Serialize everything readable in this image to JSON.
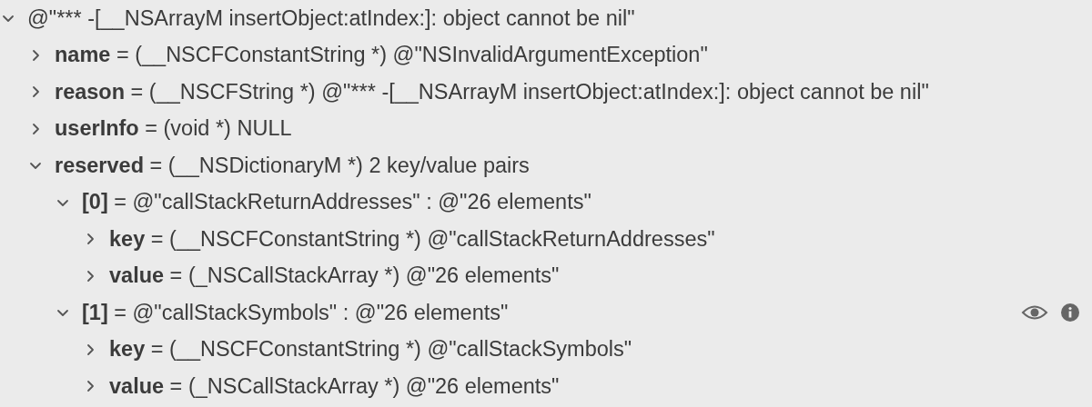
{
  "variables": [
    {
      "value": "@\"*** -[__NSArrayM insertObject:atIndex:]: object cannot be nil\"",
      "expanded": true,
      "hovered": false,
      "children": [
        {
          "name": "name",
          "value": " = (__NSCFConstantString *) @\"NSInvalidArgumentException\"",
          "expanded": false,
          "hovered": false
        },
        {
          "name": "reason",
          "value": " = (__NSCFString *) @\"*** -[__NSArrayM insertObject:atIndex:]: object cannot be nil\"",
          "expanded": false,
          "hovered": false
        },
        {
          "name": "userInfo",
          "value": " = (void *) NULL",
          "expanded": false,
          "hovered": false
        },
        {
          "name": "reserved",
          "value": " = (__NSDictionaryM *) 2 key/value pairs",
          "expanded": true,
          "hovered": false,
          "children": [
            {
              "name": "[**0**]",
              "value": " = @\"callStackReturnAddresses\" : @\"26 elements\"",
              "expanded": true,
              "hovered": false,
              "children": [
                {
                  "name": "key",
                  "value": " = (__NSCFConstantString *) @\"callStackReturnAddresses\"",
                  "expanded": false,
                  "hovered": false
                },
                {
                  "name": "value",
                  "value": " = (_NSCallStackArray *) @\"26 elements\"",
                  "expanded": false,
                  "hovered": false
                }
              ]
            },
            {
              "name": "[**1**]",
              "value": " = @\"callStackSymbols\" : @\"26 elements\"",
              "expanded": true,
              "hovered": true,
              "children": [
                {
                  "name": "key",
                  "value": " = (__NSCFConstantString *) @\"callStackSymbols\"",
                  "expanded": false,
                  "hovered": false
                },
                {
                  "name": "value",
                  "value": " = (_NSCallStackArray *) @\"26 elements\"",
                  "expanded": false,
                  "hovered": false
                }
              ]
            }
          ]
        }
      ]
    }
  ]
}
